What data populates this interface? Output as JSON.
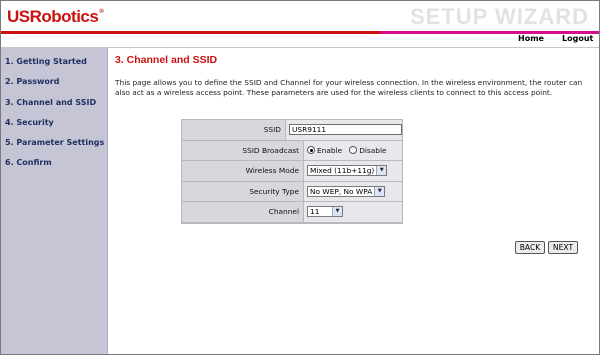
{
  "header": {
    "brand": "USRobotics",
    "brand_mark": "®",
    "wizard_title": "SETUP WIZARD"
  },
  "topnav": {
    "home": "Home",
    "logout": "Logout"
  },
  "sidebar": {
    "items": [
      "1. Getting Started",
      "2. Password",
      "3. Channel and SSID",
      "4. Security",
      "5. Parameter Settings",
      "6. Confirm"
    ]
  },
  "main": {
    "title": "3. Channel and SSID",
    "description": "This page allows you to define the SSID and Channel for your wireless connection.  In the wireless environment, the router can also act as a wireless access point.  These parameters are used for the wireless clients to connect to this access point."
  },
  "form": {
    "ssid_label": "SSID",
    "ssid_value": "USR9111",
    "broadcast_label": "SSID Broadcast",
    "broadcast_enable": "Enable",
    "broadcast_disable": "Disable",
    "broadcast_selected": "Enable",
    "mode_label": "Wireless Mode",
    "mode_value": "Mixed (11b+11g)",
    "security_label": "Security Type",
    "security_value": "No WEP, No WPA",
    "channel_label": "Channel",
    "channel_value": "11"
  },
  "buttons": {
    "back": "BACK",
    "next": "NEXT"
  },
  "icons": {
    "dropdown": "chevron-down-icon",
    "radio_on": "radio-selected-icon",
    "radio_off": "radio-empty-icon"
  },
  "colors": {
    "brand_red": "#cc1111",
    "accent_pink": "#d60d8c",
    "sidebar_bg": "#c5c5d6",
    "sidebar_text": "#1f2f5f"
  }
}
